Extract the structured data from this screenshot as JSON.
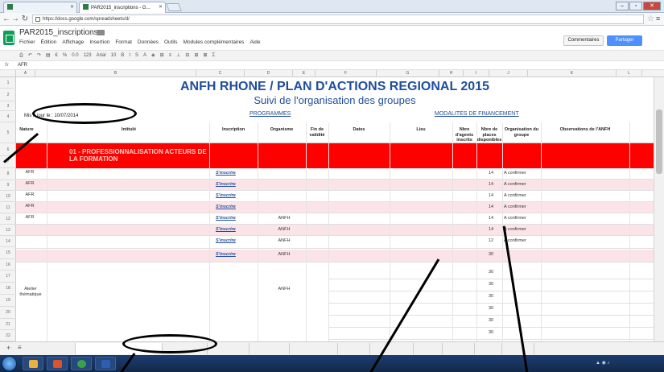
{
  "browser": {
    "tabs": [
      {
        "label": "",
        "active": false
      },
      {
        "label": "PAR2015_inscriptions - G...",
        "active": true
      }
    ],
    "url": "https://docs.google.com/spreadsheets/d/",
    "window_controls": {
      "min": "–",
      "max": "▫",
      "close": "✕"
    }
  },
  "app": {
    "doc_title": "PAR2015_inscriptions",
    "menus": [
      "Fichier",
      "Édition",
      "Affichage",
      "Insertion",
      "Format",
      "Données",
      "Outils",
      "Modules complémentaires",
      "Aide"
    ],
    "menu_note": "",
    "user_email": "",
    "comments_label": "Commentaires",
    "share_label": "Partager"
  },
  "toolbar": {
    "items": [
      "⎙",
      "↶",
      "↷",
      "▤",
      "€",
      "%",
      "0.0",
      "123",
      "Arial",
      "10",
      "B",
      "I",
      "S",
      "A",
      "◈",
      "⊞",
      "≡",
      "⊥",
      "⊟",
      "⊞",
      "⊠",
      "Σ"
    ]
  },
  "formula_bar": {
    "fx": "fx",
    "value": "AFR"
  },
  "columns": [
    "A",
    "B",
    "C",
    "D",
    "E",
    "F",
    "G",
    "H",
    "I",
    "J",
    "K",
    "L",
    "M"
  ],
  "rows": [
    "1",
    "2",
    "3",
    "4",
    "5",
    "6",
    "7",
    "8",
    "9",
    "10",
    "11",
    "12",
    "13",
    "14",
    "15",
    "16",
    "17",
    "18",
    "19",
    "20",
    "21",
    "22",
    "23"
  ],
  "sheet": {
    "main_title": "ANFH RHONE / PLAN D'ACTIONS REGIONAL 2015",
    "subtitle": "Suivi de l'organisation des groupes",
    "updated_label": "Mis à jour le : 10/07/2014",
    "programmes": "PROGRAMMES",
    "modalites": "MODALITES DE FINANCEMENT",
    "headers": {
      "nature": "Nature",
      "intitule": "Intitulé",
      "inscription": "Inscription",
      "organisme": "Organisme",
      "fin_validite": "Fin de validité",
      "dates": "Dates",
      "lieu": "Lieu",
      "nbre_agents": "Nbre d'agents inscrits",
      "nbre_places": "Nbre de places disponibles",
      "organisation": "Organisation du groupe",
      "observations": "Observations de l'ANFH"
    },
    "section": "01 - PROFESSIONNALISATION ACTEURS DE LA FORMATION",
    "rows": [
      {
        "nature": "AFR",
        "intitule": "",
        "inscription": "S'inscrire",
        "organisme": "",
        "fin": "",
        "dates": "",
        "lieu": "",
        "places": "14",
        "orga": "A confirmer",
        "pink": false
      },
      {
        "nature": "AFR",
        "intitule": "",
        "inscription": "S'inscrire",
        "organisme": "",
        "fin": "",
        "dates": "",
        "lieu": "",
        "places": "14",
        "orga": "A confirmer",
        "pink": true
      },
      {
        "nature": "AFR",
        "intitule": "",
        "inscription": "S'inscrire",
        "organisme": "",
        "fin": "",
        "dates": "",
        "lieu": "",
        "places": "14",
        "orga": "A confirmer",
        "pink": false
      },
      {
        "nature": "AFR",
        "intitule": "",
        "inscription": "S'inscrire",
        "organisme": "",
        "fin": "",
        "dates": "",
        "lieu": "",
        "places": "14",
        "orga": "A confirmer",
        "pink": true
      },
      {
        "nature": "AFR",
        "intitule": "",
        "inscription": "S'inscrire",
        "organisme": "ANFH",
        "fin": "",
        "dates": "",
        "lieu": "",
        "places": "14",
        "orga": "A confirmer",
        "pink": false
      },
      {
        "nature": "",
        "intitule": "",
        "inscription": "S'inscrire",
        "organisme": "ANFH",
        "fin": "",
        "dates": "",
        "lieu": "",
        "places": "14",
        "orga": "A confirmer",
        "pink": true
      },
      {
        "nature": "",
        "intitule": "",
        "inscription": "S'inscrire",
        "organisme": "ANFH",
        "fin": "",
        "dates": "",
        "lieu": "",
        "places": "12",
        "orga": "A confirmer",
        "pink": false
      },
      {
        "nature": "",
        "intitule": "",
        "inscription": "S'inscrire",
        "organisme": "ANFH",
        "fin": "",
        "dates": "",
        "lieu": "",
        "places": "30",
        "orga": "",
        "pink": true
      }
    ],
    "block": {
      "nature": "Atelier thématique",
      "intitule": "",
      "inscription": "",
      "organisme": "ANFH",
      "sessions": [
        {
          "dates": "",
          "lieu": "",
          "places": "30",
          "orga": ""
        },
        {
          "dates": "",
          "lieu": "",
          "places": "30",
          "orga": ""
        },
        {
          "dates": "",
          "lieu": "",
          "places": "30",
          "orga": ""
        },
        {
          "dates": "",
          "lieu": "",
          "places": "30",
          "orga": ""
        },
        {
          "dates": "",
          "lieu": "",
          "places": "30",
          "orga": ""
        },
        {
          "dates": "",
          "lieu": "",
          "places": "30",
          "orga": ""
        }
      ]
    }
  },
  "sheet_tabs": [
    {
      "label": "",
      "active": false
    },
    {
      "label": "",
      "active": true
    },
    {
      "label": "",
      "active": false
    },
    {
      "label": "",
      "active": false
    },
    {
      "label": "",
      "active": false
    },
    {
      "label": "",
      "active": false
    },
    {
      "label": "",
      "active": false
    },
    {
      "label": "",
      "active": false
    },
    {
      "label": "",
      "active": false
    },
    {
      "label": "",
      "active": false
    },
    {
      "label": "",
      "active": false
    },
    {
      "label": "",
      "active": false
    }
  ],
  "taskbar": {
    "time": "",
    "date": ""
  },
  "colors": {
    "accent_blue": "#1f4e9c",
    "section_red": "#ff0000",
    "row_pink": "#fbe4e8",
    "sheets_green": "#0f9d58"
  }
}
